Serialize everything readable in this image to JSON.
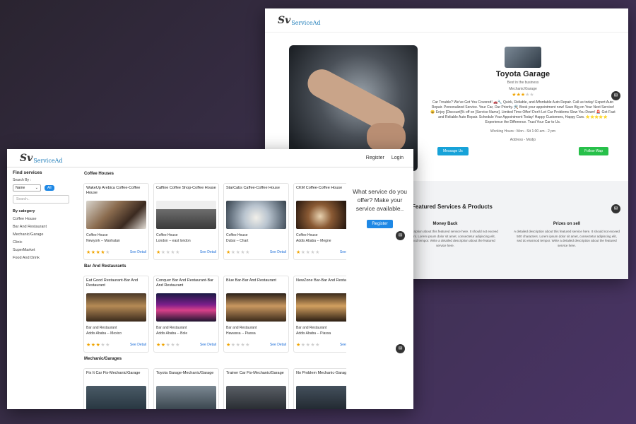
{
  "back": {
    "logo": {
      "sv": "Sv",
      "ad": "ServiceAd"
    },
    "garage": {
      "title": "Toyota Garage",
      "subtitle": "Best in the business",
      "category": "Mechanic/Garage",
      "rating": 3,
      "description": "Car Trouble? We've Got You Covered! 🚗🔧 Quick, Reliable, and Affordable Auto Repair. Call us today! Expert Auto Repair. Personalized Service. Your Car, Our Priority. 🛠️ Book your appointment now! Save Big on Your Next Service! 😀 Enjoy [Discount]% off on [Service Name]. Limited Time Offer! Don't Let Car Problems Slow You Down! 🚨 Get Fast and Reliable Auto Repair. Schedule Your Appointment Today! Happy Customers, Happy Cars. ⭐⭐⭐⭐⭐ Experience the Difference. Trust Your Car to Us.",
      "hours": "Working Hours : Mon - Sit 1:00 am - 2 pm",
      "address": "Address - Modjo",
      "message_btn": "Message Us",
      "whatsapp_btn": "Follow Wap"
    },
    "featured": {
      "title": "Featured Services & Products",
      "items": [
        {
          "title": "Money Back",
          "desc": "A detailed description about this featured service here. It should not exceed 500 characters. Lorem ipsum dolor sit amet, consectetur adipiscing elit, sed do eiusmod tempor. Write a detailed description about the featured service here."
        },
        {
          "title": "Prizes on sell",
          "desc": "A detailed description about this featured service here. It should not exceed 500 characters. Lorem ipsum dolor sit amet, consectetur adipiscing elit, sed do eiusmod tempor. Write a detailed description about the featured service here."
        }
      ]
    }
  },
  "front": {
    "logo": {
      "sv": "Sv",
      "ad": "ServiceAd"
    },
    "nav": {
      "register": "Register",
      "login": "Login"
    },
    "sidebar": {
      "title": "Find services",
      "sort_label": "Search By :",
      "sort_value": "Name",
      "all_badge": "All",
      "search_placeholder": "Search..",
      "category_title": "By category",
      "categories": [
        "Coffee House",
        "Bar And Restaurant",
        "Mechanic/Garage",
        "Clinic",
        "SuperMarket",
        "Food And Drink"
      ]
    },
    "sections": [
      {
        "title": "Coffee Houses",
        "cards": [
          {
            "title": "WakeUp Arebica Coffee-Coffee House",
            "type": "Coffee House",
            "loc": "Newyork -- Manhatan",
            "rating": 4,
            "see": "See Detail"
          },
          {
            "title": "Caffine Coffee Shop-Coffee House",
            "type": "Coffee House",
            "loc": "London -- east london",
            "rating": 1,
            "see": "See Detail"
          },
          {
            "title": "StarCabs Caffee-Coffee House",
            "type": "Coffee House",
            "loc": "Dubai -- Chart",
            "rating": 1,
            "see": "See Detail"
          },
          {
            "title": "CKM Coffee-Coffee House",
            "type": "Coffee House",
            "loc": "Addis Ababa -- Megne",
            "rating": 1,
            "see": "See Detail"
          }
        ]
      },
      {
        "title": "Bar And Restaurants",
        "cards": [
          {
            "title": "Eat Good Restaurant-Bar And Restaurant",
            "type": "Bar and Restaurant",
            "loc": "Addis Ababa -- Mexico",
            "rating": 3,
            "see": "See Detail"
          },
          {
            "title": "Conquer Bar And Restaurant-Bar And Restaurant",
            "type": "Bar and Restaurant",
            "loc": "Addis Ababa -- Bole",
            "rating": 2,
            "see": "See Detail"
          },
          {
            "title": "Blue Bar-Bar And Restaurant",
            "type": "Bar and Restaurant",
            "loc": "Hawassa -- Piassa",
            "rating": 1,
            "see": "See Detail"
          },
          {
            "title": "NewZone Bar-Bar And Restaurant",
            "type": "Bar and Restaurant",
            "loc": "Addis Ababa -- Piassa",
            "rating": 1,
            "see": "See Detail"
          }
        ]
      },
      {
        "title": "Mechanic/Garages",
        "cards": [
          {
            "title": "Fix It Car Fix-Mechanic/Garage",
            "type": "",
            "loc": "",
            "rating": 0,
            "see": ""
          },
          {
            "title": "Toyota Garage-Mechanic/Garage",
            "type": "",
            "loc": "",
            "rating": 0,
            "see": ""
          },
          {
            "title": "Trainer Car Fix-Mechanic/Garage",
            "type": "",
            "loc": "",
            "rating": 0,
            "see": ""
          },
          {
            "title": "No Problem Mechanic-Garage",
            "type": "",
            "loc": "",
            "rating": 0,
            "see": ""
          }
        ]
      }
    ],
    "prompt": {
      "text": "What service do you offer? Make your service available..",
      "button": "Register"
    }
  }
}
